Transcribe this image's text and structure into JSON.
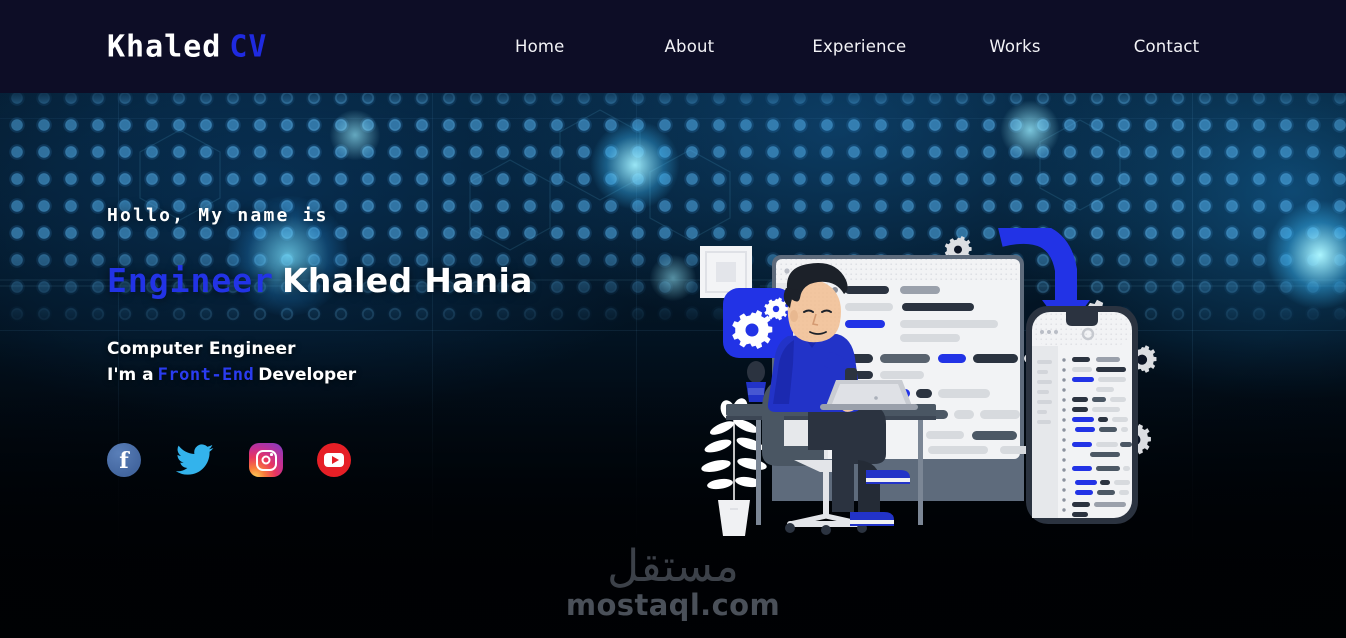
{
  "header": {
    "logo": {
      "name": "Khaled",
      "suffix": "CV"
    },
    "nav": [
      {
        "label": "Home"
      },
      {
        "label": "About"
      },
      {
        "label": "Experience"
      },
      {
        "label": "Works"
      },
      {
        "label": "Contact"
      }
    ]
  },
  "hero": {
    "greeting": "Hollo, My name is",
    "headline_highlight": "Engineer",
    "headline_name": "Khaled Hania",
    "subtitle_1": "Computer Engineer",
    "subtitle_2_prefix": "I'm a",
    "subtitle_2_highlight": "Front-End",
    "subtitle_2_suffix": "Developer"
  },
  "socials": [
    {
      "name": "facebook",
      "glyph": "f"
    },
    {
      "name": "twitter",
      "glyph": "bird"
    },
    {
      "name": "instagram",
      "glyph": "camera"
    },
    {
      "name": "youtube",
      "glyph": "play"
    }
  ],
  "watermark": {
    "arabic": "مستقل",
    "latin": "mostaql.com"
  },
  "colors": {
    "header_bg": "#0d0d26",
    "accent_blue": "#2233e6",
    "logo_blue": "#1f2ae0",
    "text_white": "#ffffff",
    "bg_deep": "#04060c",
    "glow_cyan": "#6fe0ff",
    "facebook": "#43669f",
    "twitter": "#33b3ec",
    "youtube": "#e61f26",
    "watermark_grey": "#4a5059"
  },
  "illustration": {
    "name": "developer-at-desk-illustration",
    "elements": [
      "monitor-with-code",
      "developer-character",
      "laptop",
      "smartphone-in-hand",
      "desk",
      "office-chair",
      "potted-plant",
      "mobile-phone-with-code",
      "gears",
      "blue-curved-arrow",
      "blue-gear-badge",
      "white-square-frame"
    ]
  }
}
